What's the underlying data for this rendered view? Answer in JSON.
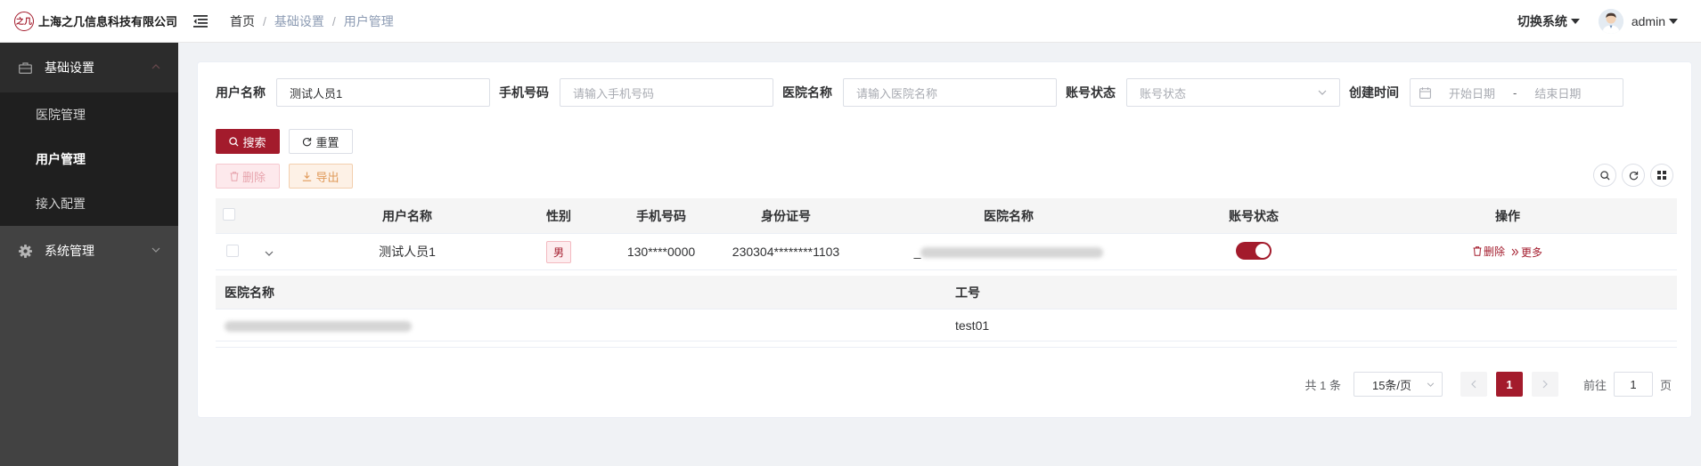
{
  "header": {
    "company": "上海之几信息科技有限公司",
    "logo_mark": "之几",
    "breadcrumb": [
      "首页",
      "基础设置",
      "用户管理"
    ],
    "switch_system": "切换系统",
    "user": "admin"
  },
  "sidebar": {
    "groups": [
      {
        "label": "基础设置",
        "icon": "briefcase-icon",
        "expanded": true,
        "items": [
          "医院管理",
          "用户管理",
          "接入配置"
        ],
        "active_item": "用户管理"
      },
      {
        "label": "系统管理",
        "icon": "gear-icon",
        "expanded": false
      }
    ]
  },
  "filters": {
    "username": {
      "label": "用户名称",
      "value": "测试人员1"
    },
    "phone": {
      "label": "手机号码",
      "placeholder": "请输入手机号码"
    },
    "hospital": {
      "label": "医院名称",
      "placeholder": "请输入医院名称"
    },
    "status": {
      "label": "账号状态",
      "placeholder": "账号状态"
    },
    "created": {
      "label": "创建时间",
      "start_placeholder": "开始日期",
      "separator": "-",
      "end_placeholder": "结束日期"
    },
    "search_button": "搜索",
    "reset_button": "重置"
  },
  "toolbar": {
    "delete_button": "删除",
    "export_button": "导出"
  },
  "table": {
    "columns": [
      "用户名称",
      "性别",
      "手机号码",
      "身份证号",
      "医院名称",
      "账号状态",
      "操作"
    ],
    "rows": [
      {
        "username": "测试人员1",
        "gender": "男",
        "phone": "130****0000",
        "id_card": "230304********1103",
        "hospital_prefix": "_",
        "status_enabled": true,
        "delete_link": "删除",
        "more_link": "更多"
      }
    ],
    "expanded": {
      "columns": [
        "医院名称",
        "工号"
      ],
      "rows": [
        {
          "employee_no": "test01"
        }
      ]
    }
  },
  "pagination": {
    "total": "共 1 条",
    "page_size": "15条/页",
    "current_page": "1",
    "goto_label": "前往",
    "goto_value": "1",
    "goto_suffix": "页"
  },
  "colors": {
    "brand": "#a31b2c",
    "sidebar_bg": "#424242",
    "sidebar_active_bg": "#2c2c2c",
    "submenu_bg": "#1f1f1f"
  }
}
